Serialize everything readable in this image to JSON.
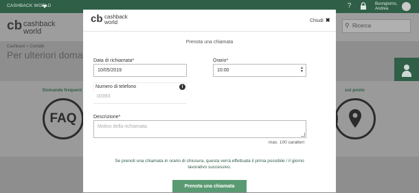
{
  "background": {
    "topbar": {
      "brand": "CASHBACK WORLD",
      "greeting_line1": "Buongiorno,",
      "greeting_line2": "Andrea",
      "icons": [
        "question-icon",
        "lock-icon",
        "user-icon"
      ]
    },
    "logo": {
      "mark": "cb",
      "line1": "cashback",
      "line2": "world"
    },
    "search": {
      "placeholder": "Ricerca"
    },
    "breadcrumb": "Cashback > Contatti",
    "page_title": "Per ulteriori domar",
    "band": {
      "left_label": "Domande frequent",
      "right_label": "sul posto",
      "faq_text": "FAQ"
    }
  },
  "modal": {
    "logo": {
      "mark": "cb",
      "line1": "cashback",
      "line2": "world"
    },
    "close_label": "Chiudi",
    "title": "Prenota una chiamata",
    "date": {
      "label": "Data di richiamata*",
      "value": "10/05/2019"
    },
    "time": {
      "label": "Orario*",
      "value": "10:00"
    },
    "phone": {
      "label": "Numero di telefono",
      "placeholder": "00393"
    },
    "description": {
      "label": "Descrizione*",
      "placeholder": "Motivo della richiamata.",
      "max_hint": "max. 100 caratteri"
    },
    "note": "Se prenoti una chiamata in orario di chiusura, questa verrà effettuata il prima possibile / il giorno lavorativo successivo.",
    "submit_label": "Prenota una chiamata"
  },
  "colors": {
    "brand_green": "#2f5f47",
    "button_green": "#5a9a72",
    "overlay": "#8e8e8e"
  }
}
